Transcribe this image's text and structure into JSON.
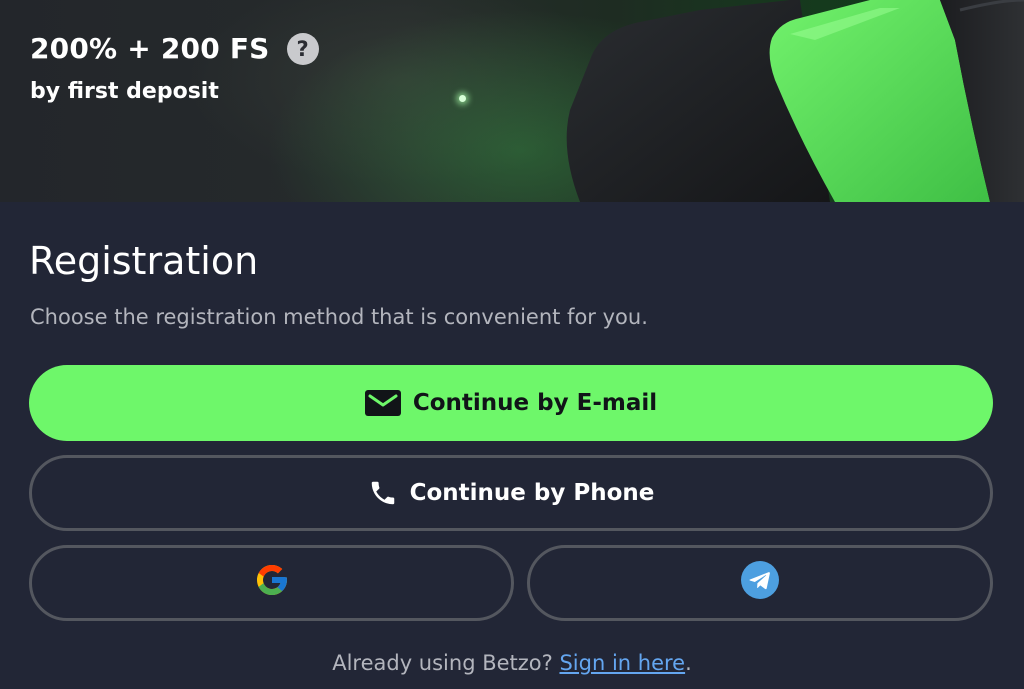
{
  "banner": {
    "bonus_title": "200% + 200 FS",
    "help_symbol": "?",
    "bonus_subtitle": "by first deposit"
  },
  "registration": {
    "title": "Registration",
    "description": "Choose the registration method that is convenient for you.",
    "email_button_label": "Continue by E-mail",
    "email_icon": "envelope-icon",
    "phone_button_label": "Continue by Phone",
    "phone_icon": "phone-icon",
    "google_icon": "google-icon",
    "telegram_icon": "telegram-icon"
  },
  "footer": {
    "prompt": "Already using Betzo?",
    "signin_link": "Sign in here",
    "period": "."
  },
  "colors": {
    "background": "#222636",
    "accent_green": "#6ef76a",
    "button_border": "#54575f",
    "link_blue": "#64a6f0",
    "muted_text": "#b3b5bd"
  }
}
